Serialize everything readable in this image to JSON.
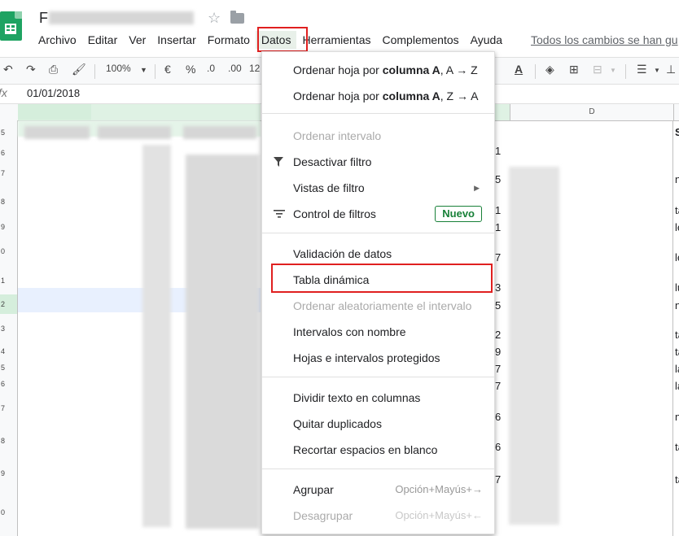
{
  "doc": {
    "title_initial": "F"
  },
  "menubar": {
    "items": [
      "Archivo",
      "Editar",
      "Ver",
      "Insertar",
      "Formato",
      "Datos",
      "Herramientas",
      "Complementos",
      "Ayuda"
    ],
    "saved_status": "Todos los cambios se han gu"
  },
  "toolbar": {
    "zoom": "100%",
    "currency": "€",
    "percent": "%",
    "dec_less": ".0",
    "dec_more": ".00",
    "format_123": "12"
  },
  "formula_bar": {
    "fx": "fx",
    "value": "01/01/2018"
  },
  "columns": {
    "d": "D"
  },
  "rows": [
    "5",
    "6",
    "7",
    "8",
    "9",
    "0",
    "1",
    "2",
    "3",
    "4",
    "5",
    "6",
    "7",
    "8",
    "9",
    "0"
  ],
  "menu": {
    "sort_a_to_z": {
      "pre": "Ordenar hoja por ",
      "bold": "columna A",
      "post": ", A → Z"
    },
    "sort_z_to_a": {
      "pre": "Ordenar hoja por ",
      "bold": "columna A",
      "post": ", Z → A"
    },
    "sort_range": "Ordenar intervalo",
    "disable_filter": "Desactivar filtro",
    "filter_views": "Vistas de filtro",
    "slicer": "Control de filtros",
    "new_badge": "Nuevo",
    "data_validation": "Validación de datos",
    "pivot_table": "Tabla dinámica",
    "randomize": "Ordenar aleatoriamente el intervalo",
    "named_ranges": "Intervalos con nombre",
    "protected": "Hojas e intervalos protegidos",
    "split_text": "Dividir texto en columnas",
    "remove_duplicates": "Quitar duplicados",
    "trim_whitespace": "Recortar espacios en blanco",
    "group": "Agrupar",
    "group_shortcut": "Opción+Mayús+→",
    "ungroup": "Desagrupar",
    "ungroup_shortcut": "Opción+Mayús+←"
  },
  "right_cells": [
    "S",
    "n",
    "ta",
    "le",
    "le",
    "lu",
    "n",
    "ta",
    "ta",
    "la",
    "la",
    "n",
    "ta",
    "ta"
  ],
  "mid_cells": [
    "1",
    "5",
    "1",
    "1",
    "7",
    "3",
    "5",
    "2",
    "9",
    "7",
    "7",
    "6",
    "6",
    "7"
  ]
}
